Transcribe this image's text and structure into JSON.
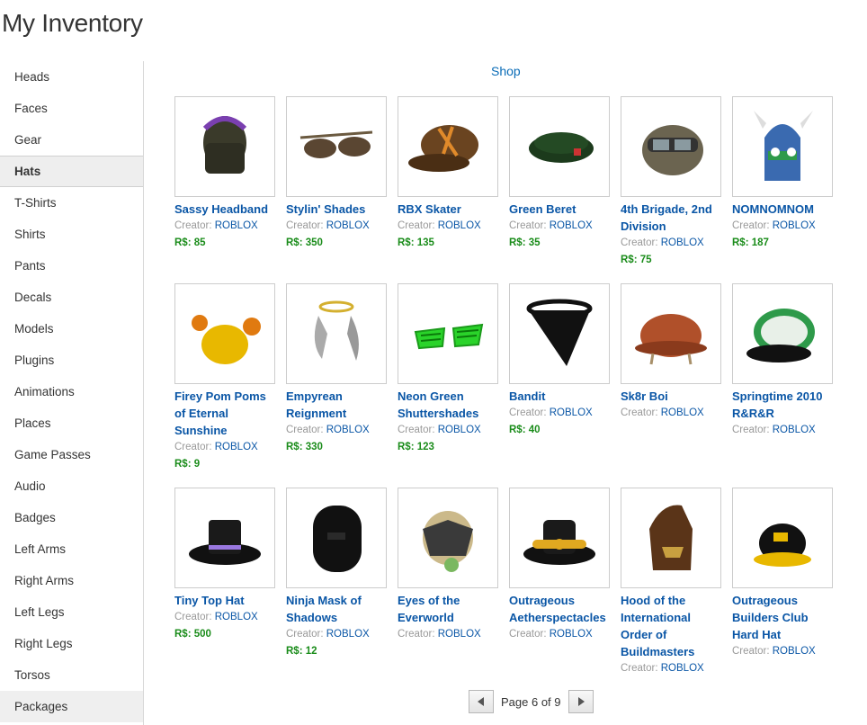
{
  "page_title": "My Inventory",
  "sidebar": {
    "items": [
      "Heads",
      "Faces",
      "Gear",
      "Hats",
      "T-Shirts",
      "Shirts",
      "Pants",
      "Decals",
      "Models",
      "Plugins",
      "Animations",
      "Places",
      "Game Passes",
      "Audio",
      "Badges",
      "Left Arms",
      "Right Arms",
      "Left Legs",
      "Right Legs",
      "Torsos",
      "Packages"
    ],
    "active": "Hats"
  },
  "shop_link": "Shop",
  "creator_label": "Creator:",
  "items": [
    {
      "name": "Sassy Headband",
      "creator": "ROBLOX",
      "price": "R$: 85",
      "icon": "headband-hat-icon"
    },
    {
      "name": "Stylin' Shades",
      "creator": "ROBLOX",
      "price": "R$: 350",
      "icon": "sunglasses-icon"
    },
    {
      "name": "RBX Skater",
      "creator": "ROBLOX",
      "price": "R$: 135",
      "icon": "skater-cap-icon"
    },
    {
      "name": "Green Beret",
      "creator": "ROBLOX",
      "price": "R$: 35",
      "icon": "beret-icon"
    },
    {
      "name": "4th Brigade, 2nd Division",
      "creator": "ROBLOX",
      "price": "R$: 75",
      "icon": "army-helmet-icon"
    },
    {
      "name": "NOMNOMNOM",
      "creator": "ROBLOX",
      "price": "R$: 187",
      "icon": "monster-hat-icon"
    },
    {
      "name": "Firey Pom Poms of Eternal Sunshine",
      "creator": "ROBLOX",
      "price": "R$: 9",
      "icon": "pom-pom-hat-icon"
    },
    {
      "name": "Empyrean Reignment",
      "creator": "ROBLOX",
      "price": "R$: 330",
      "icon": "halo-wings-icon"
    },
    {
      "name": "Neon Green Shuttershades",
      "creator": "ROBLOX",
      "price": "R$: 123",
      "icon": "shutter-shades-icon"
    },
    {
      "name": "Bandit",
      "creator": "ROBLOX",
      "price": "R$: 40",
      "icon": "bandana-icon"
    },
    {
      "name": "Sk8r Boi",
      "creator": "ROBLOX",
      "price": "",
      "icon": "helmet-icon"
    },
    {
      "name": "Springtime 2010 R&R&R",
      "creator": "ROBLOX",
      "price": "",
      "icon": "roblox-cap-icon"
    },
    {
      "name": "Tiny Top Hat",
      "creator": "ROBLOX",
      "price": "R$: 500",
      "icon": "top-hat-icon"
    },
    {
      "name": "Ninja Mask of Shadows",
      "creator": "ROBLOX",
      "price": "R$: 12",
      "icon": "ninja-mask-icon"
    },
    {
      "name": "Eyes of the Everworld",
      "creator": "ROBLOX",
      "price": "",
      "icon": "mech-helmet-icon"
    },
    {
      "name": "Outrageous Aetherspectacles",
      "creator": "ROBLOX",
      "price": "",
      "icon": "goggle-hat-icon"
    },
    {
      "name": "Hood of the International Order of Buildmasters",
      "creator": "ROBLOX",
      "price": "",
      "icon": "hood-icon"
    },
    {
      "name": "Outrageous Builders Club Hard Hat",
      "creator": "ROBLOX",
      "price": "",
      "icon": "hard-hat-icon"
    }
  ],
  "pager": {
    "text": "Page 6 of 9"
  },
  "colors": {
    "link": "#0a56a6",
    "price": "#1a8c1a",
    "muted": "#999999"
  }
}
